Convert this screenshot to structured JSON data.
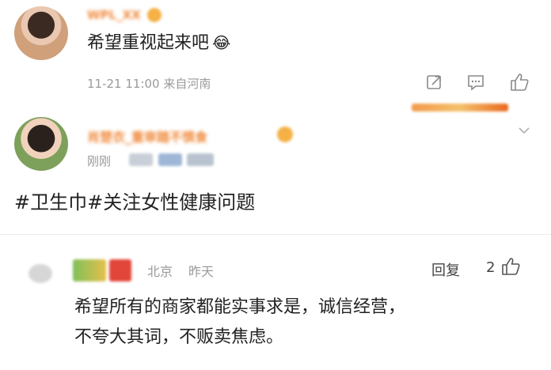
{
  "comment1": {
    "username": "WPL_XX",
    "text": "希望重视起来吧",
    "emoji": "😂",
    "meta": "11-21 11:00 来自河南"
  },
  "comment2": {
    "username": "肖楚衣_重审踏不惧食",
    "time": "刚刚"
  },
  "hashtags": "#卫生巾#关注女性健康问题",
  "reply": {
    "location": "北京",
    "time": "昨天",
    "reply_label": "回复",
    "like_count": "2",
    "text_line1": "希望所有的商家都能实事求是，诚信经营，",
    "text_line2": "不夸大其词，不贩卖焦虑。"
  },
  "colors": {
    "accent": "#e8681f",
    "hashtag": "#222222",
    "muted": "#9a9a9a"
  }
}
